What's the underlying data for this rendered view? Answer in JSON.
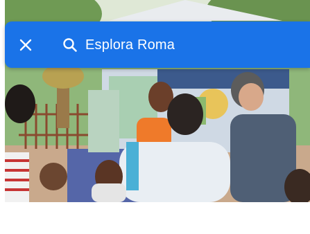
{
  "search": {
    "placeholder": "Esplora Roma"
  },
  "icons": {
    "close": "close-icon",
    "search": "search-icon"
  },
  "colors": {
    "accent": "#1a73e8",
    "on_accent": "#ffffff",
    "background": "#ffffff"
  }
}
